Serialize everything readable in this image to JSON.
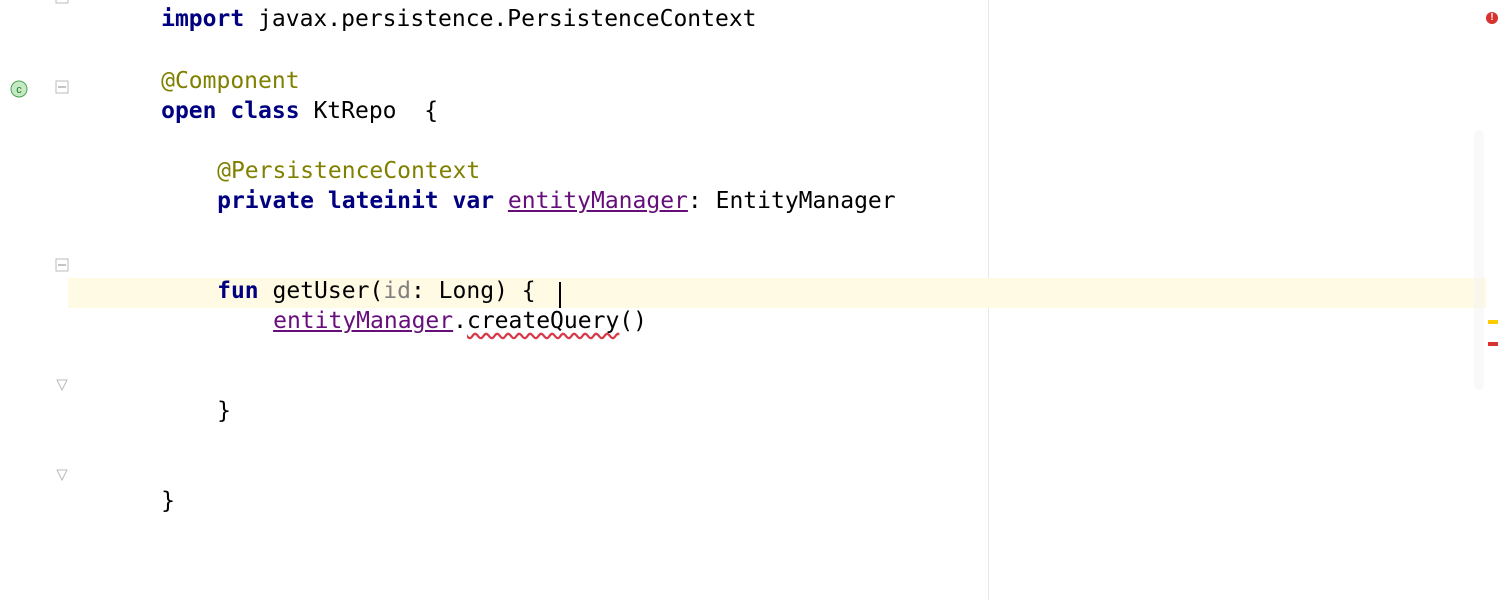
{
  "code": {
    "l0": {
      "imp": "import",
      "rest": " javax.persistence.PersistenceContext"
    },
    "l1": {
      "ann": "@Component"
    },
    "l2": {
      "open": "open ",
      "cls": "class ",
      "name": "KtRepo ",
      "brace": " {"
    },
    "l3": {
      "ann": "@PersistenceContext"
    },
    "l4": {
      "priv": "private ",
      "late": "lateinit ",
      "var": "var ",
      "em": "entityManager",
      "colon": ": EntityManager"
    },
    "l5": {
      "fun": "fun ",
      "name": "getUser",
      "lp": "(",
      "param": "id",
      "ptype": ": Long",
      "rp": ") {"
    },
    "l6": {
      "em": "entityManager",
      "dot": ".",
      "cq": "createQuery",
      "lp": "(",
      "rp": ")"
    },
    "l7": {
      "brace": "}"
    },
    "l8": {
      "brace": "}"
    }
  },
  "gutter": {
    "class_icon": "class-icon"
  },
  "markers": {
    "error": "!",
    "warn1": "warn",
    "err1": "err"
  }
}
